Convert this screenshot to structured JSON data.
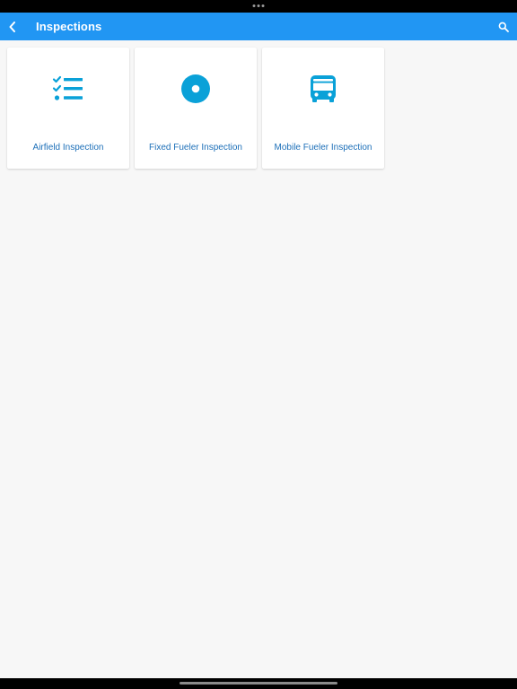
{
  "app_bar": {
    "title": "Inspections",
    "back_icon": "chevron-left-icon",
    "search_icon": "search-icon"
  },
  "colors": {
    "app_bar": "#2196f3",
    "icon_accent": "#0aa1d8",
    "label": "#1c6fb8",
    "background": "#f7f7f7"
  },
  "tiles": [
    {
      "label": "Airfield Inspection",
      "icon": "checklist-icon"
    },
    {
      "label": "Fixed Fueler Inspection",
      "icon": "target-dot-icon"
    },
    {
      "label": "Mobile Fueler Inspection",
      "icon": "bus-icon"
    }
  ]
}
